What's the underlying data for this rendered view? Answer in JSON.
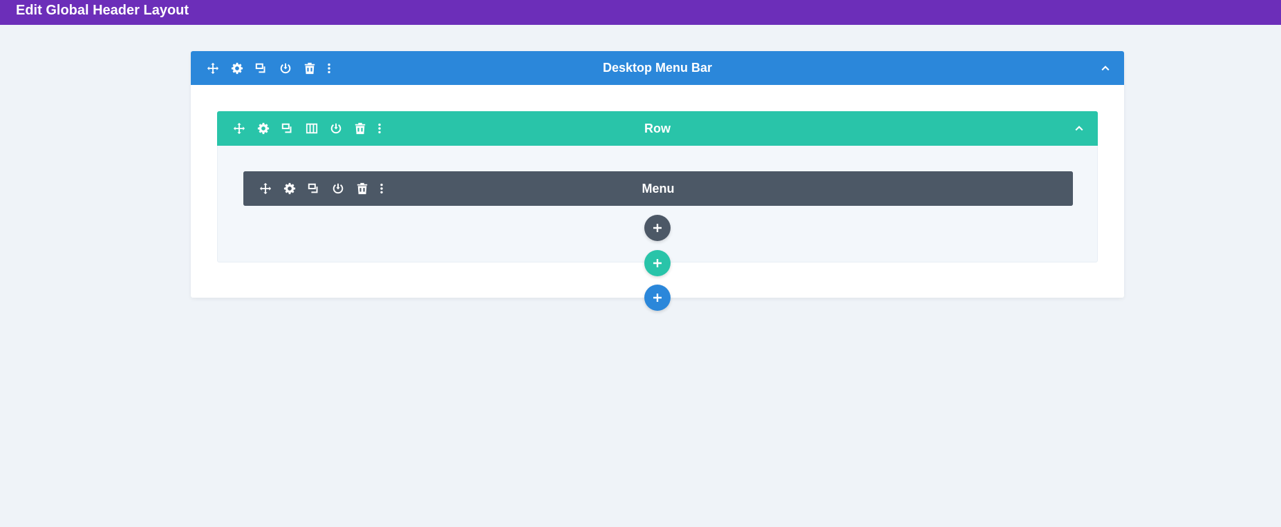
{
  "header": {
    "title": "Edit Global Header Layout",
    "color": "#6c2eb9"
  },
  "section": {
    "title": "Desktop Menu Bar",
    "color": "#2b87da",
    "tools": [
      "move-icon",
      "gear-icon",
      "duplicate-icon",
      "power-icon",
      "trash-icon",
      "more-vertical-icon"
    ]
  },
  "row": {
    "title": "Row",
    "color": "#29c4a9",
    "tools": [
      "move-icon",
      "gear-icon",
      "duplicate-icon",
      "columns-icon",
      "power-icon",
      "trash-icon",
      "more-vertical-icon"
    ]
  },
  "module": {
    "title": "Menu",
    "color": "#4c5866",
    "tools": [
      "move-icon",
      "gear-icon",
      "duplicate-icon",
      "power-icon",
      "trash-icon",
      "more-vertical-icon"
    ]
  },
  "add_buttons": {
    "module": {
      "icon": "plus-icon",
      "color": "#4c5866"
    },
    "row": {
      "icon": "plus-icon",
      "color": "#29c4a9"
    },
    "section": {
      "icon": "plus-icon",
      "color": "#2b87da"
    }
  },
  "background": "#eff3f8"
}
